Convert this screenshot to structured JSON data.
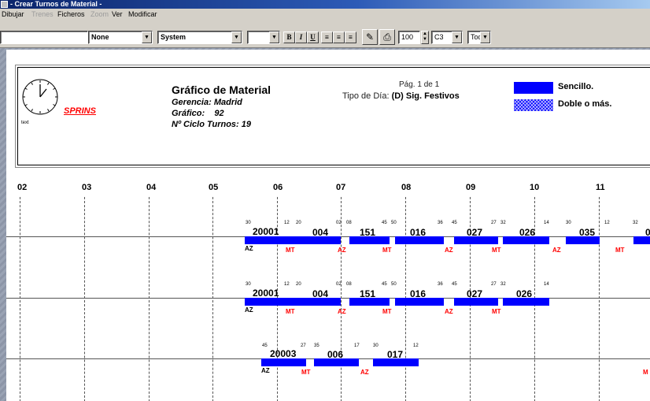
{
  "window": {
    "title": "- Crear Turnos de Material -"
  },
  "menu": [
    "Dibujar",
    "Trenes",
    "Ficheros",
    "Zoom",
    "Ver",
    "Modificar"
  ],
  "toolbar": {
    "combo_1": "",
    "combo_2": "None",
    "combo_3": "System",
    "combo_4": "",
    "format_buttons": [
      "B",
      "I",
      "U"
    ],
    "zoom": "100",
    "combo_5": "C3",
    "combo_6": "Tod"
  },
  "header": {
    "clock_label": "text",
    "company": "SPRINS",
    "title": "Gráfico de Material",
    "gerencia_label": "Gerencia:",
    "gerencia_value": "Madrid",
    "grafico_label": "Gráfico:",
    "grafico_value": "92",
    "ciclo_label": "Nº Ciclo Turnos:",
    "ciclo_value": "19",
    "page": "Pág. 1 de 1",
    "tipo_label": "Tipo de Día:",
    "tipo_value": "(D) Sig. Festivos",
    "legend_single": "Sencillo.",
    "legend_double": "Doble o más."
  },
  "colors": {
    "bar": "#0000ff",
    "station_red": "#ff0000",
    "station_black": "#000000"
  },
  "hours": [
    "02",
    "03",
    "04",
    "05",
    "06",
    "07",
    "08",
    "09",
    "10",
    "11"
  ],
  "rows": [
    {
      "trains": [
        "20001",
        "004",
        "151",
        "016",
        "027",
        "026",
        "035",
        "0"
      ],
      "minutes": [
        "30",
        "12",
        "20",
        "02",
        "08",
        "45",
        "50",
        "36",
        "45",
        "27",
        "32",
        "14",
        "30",
        "12",
        "32"
      ],
      "stations": [
        "AZ",
        "MT",
        "AZ",
        "MT",
        "AZ",
        "MT",
        "AZ",
        "MT"
      ]
    },
    {
      "trains": [
        "20001",
        "004",
        "151",
        "016",
        "027",
        "026"
      ],
      "minutes": [
        "30",
        "12",
        "20",
        "02",
        "08",
        "45",
        "50",
        "36",
        "45",
        "27",
        "32",
        "14"
      ],
      "stations": [
        "AZ",
        "MT",
        "AZ",
        "MT",
        "AZ",
        "MT"
      ]
    },
    {
      "trains": [
        "20003",
        "006",
        "017"
      ],
      "minutes": [
        "45",
        "27",
        "35",
        "17",
        "30",
        "12"
      ],
      "stations": [
        "AZ",
        "MT",
        "AZ",
        "M"
      ]
    }
  ]
}
